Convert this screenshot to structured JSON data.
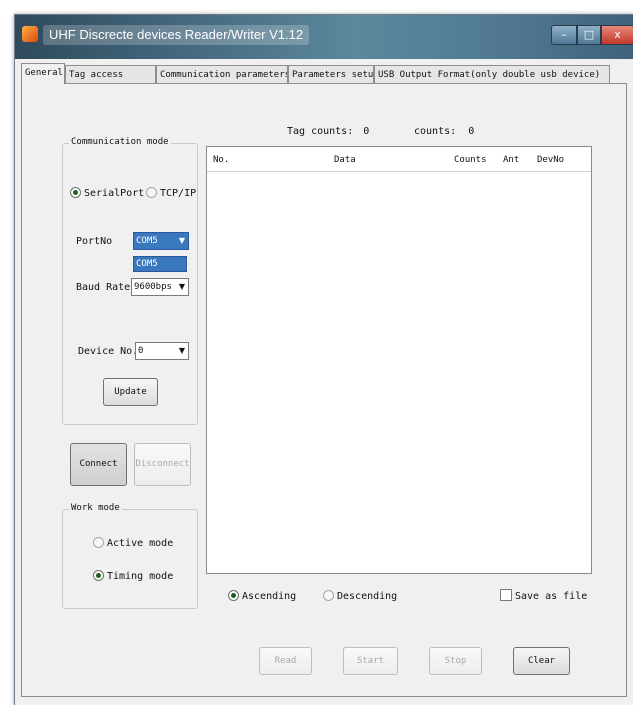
{
  "window": {
    "title": "UHF Discrecte devices Reader/Writer V1.12",
    "controls": {
      "minimize": "–",
      "maximize": "□",
      "close": "x"
    }
  },
  "tabs": [
    "General",
    "Tag access",
    "Communication parameters",
    "Parameters setup",
    "USB Output Format(only double usb device)"
  ],
  "active_tab": "General",
  "communication_mode": {
    "label": "Communication mode",
    "serial_port_label": "SerialPort",
    "tcpip_label": "TCP/IP",
    "selected": "SerialPort",
    "port_label": "PortNo",
    "port_value": "COM5",
    "port_dropdown_options": [
      "COM5"
    ],
    "baud_label": "Baud Rate",
    "baud_value": "9600bps",
    "device_label": "Device No.",
    "device_value": "0",
    "update_button": "Update"
  },
  "connection": {
    "connect_button": "Connect",
    "disconnect_button": "Disconnect"
  },
  "work_mode": {
    "label": "Work mode",
    "active_mode_label": "Active mode",
    "timing_mode_label": "Timing mode",
    "selected": "Timing mode"
  },
  "counters": {
    "tag_counts_label": "Tag counts:",
    "tag_counts_value": "0",
    "counts_label": "counts:",
    "counts_value": "0"
  },
  "table": {
    "columns": [
      "No.",
      "Data",
      "Counts",
      "Ant",
      "DevNo"
    ],
    "rows": []
  },
  "sort": {
    "ascending_label": "Ascending",
    "descending_label": "Descending",
    "selected": "Ascending"
  },
  "save_as_file": {
    "label": "Save as file",
    "checked": false
  },
  "actions": {
    "read": "Read",
    "start": "Start",
    "stop": "Stop",
    "clear": "Clear"
  }
}
